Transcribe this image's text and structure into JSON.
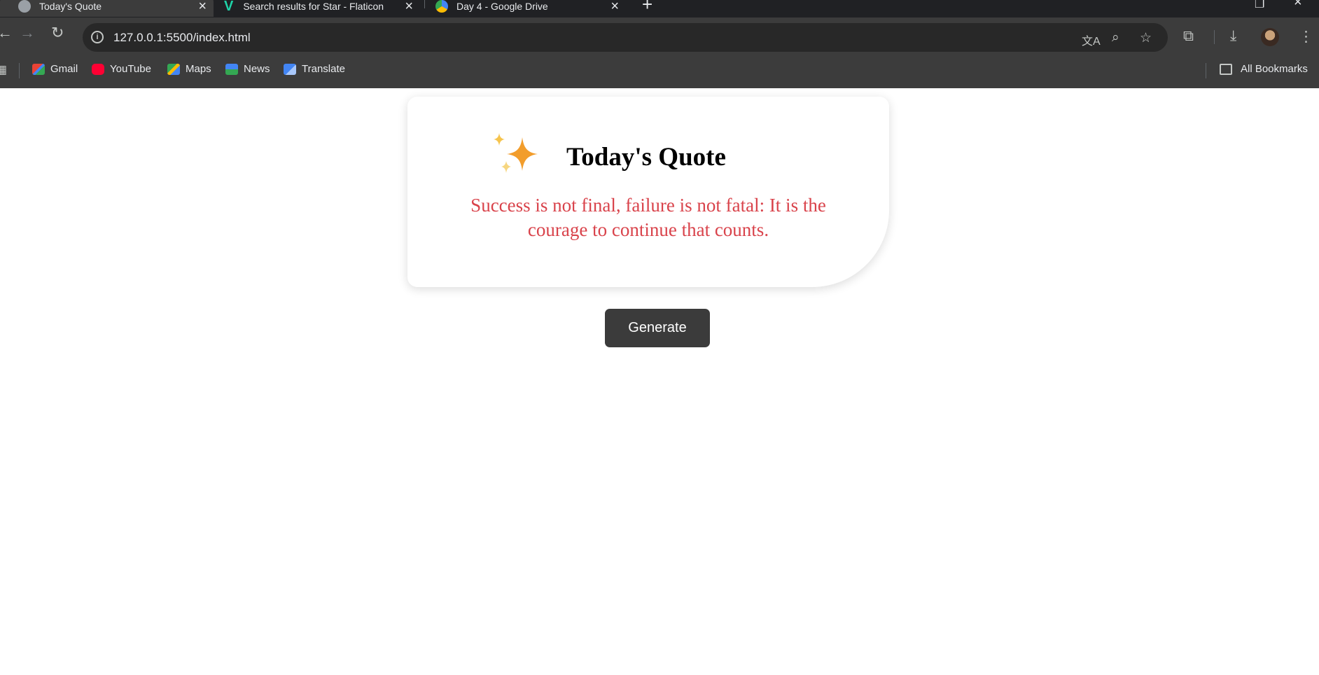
{
  "browser": {
    "tabs": [
      {
        "title": "Today's Quote",
        "active": true
      },
      {
        "title": "Search results for Star - Flaticon",
        "active": false
      },
      {
        "title": "Day 4 - Google Drive",
        "active": false
      }
    ],
    "address_bar": {
      "url": "127.0.0.1:5500/index.html"
    },
    "bookmarks": [
      {
        "label": "Gmail",
        "icon": "gmail-icon"
      },
      {
        "label": "YouTube",
        "icon": "youtube-icon"
      },
      {
        "label": "Maps",
        "icon": "maps-icon"
      },
      {
        "label": "News",
        "icon": "news-icon"
      },
      {
        "label": "Translate",
        "icon": "translate-icon"
      }
    ],
    "all_bookmarks_label": "All Bookmarks"
  },
  "page": {
    "card_title": "Today's Quote",
    "quote": "Success is not final, failure is not fatal: It is the courage to continue that counts.",
    "generate_label": "Generate",
    "colors": {
      "quote_text": "#d9434b",
      "button_bg": "#3b3b3b",
      "sparkle_orange": "#f29d2c",
      "sparkle_yellow": "#f6c44d"
    }
  }
}
